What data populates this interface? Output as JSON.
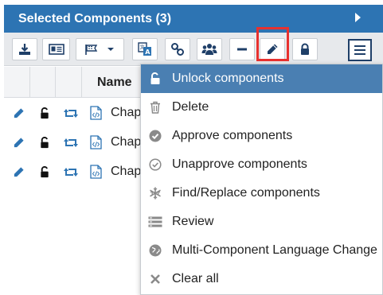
{
  "panel": {
    "title": "Selected Components (3)"
  },
  "toolbar": {
    "buttons": [
      {
        "icon": "download-icon"
      },
      {
        "icon": "id-card-icon"
      },
      {
        "icon": "flag-dropdown-icon"
      },
      {
        "icon": "translate-icon"
      },
      {
        "icon": "link-icon"
      },
      {
        "icon": "users-icon"
      },
      {
        "icon": "minus-icon"
      },
      {
        "icon": "pencil-icon"
      },
      {
        "icon": "lock-icon"
      },
      {
        "icon": "menu-icon"
      }
    ]
  },
  "grid": {
    "name_header": "Name",
    "rows": [
      {
        "label": "Chapt"
      },
      {
        "label": "Chapt"
      },
      {
        "label": "Chapt"
      }
    ]
  },
  "menu": {
    "items": [
      {
        "label": "Unlock components",
        "icon": "unlock-icon",
        "active": true
      },
      {
        "label": "Delete",
        "icon": "trash-icon"
      },
      {
        "label": "Approve components",
        "icon": "check-circle-icon"
      },
      {
        "label": "Unapprove components",
        "icon": "check-circle-outline-icon"
      },
      {
        "label": "Find/Replace components",
        "icon": "snowflake-icon"
      },
      {
        "label": "Review",
        "icon": "review-icon"
      },
      {
        "label": "Multi-Component Language Change",
        "icon": "globe-icon"
      },
      {
        "label": "Clear all",
        "icon": "close-icon"
      }
    ]
  },
  "colors": {
    "header": "#2d74b3",
    "active_menu": "#4a7fb2",
    "highlight": "#e8312f",
    "icon_blue": "#2d74b3",
    "icon_dark": "#1f3f68"
  }
}
